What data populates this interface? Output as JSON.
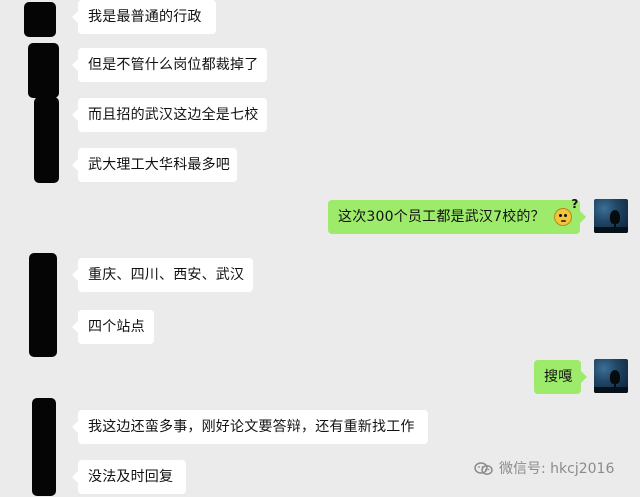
{
  "chat": {
    "messages": [
      {
        "direction": "incoming",
        "text": "我是最普通的行政"
      },
      {
        "direction": "incoming",
        "text": "但是不管什么岗位都裁掉了"
      },
      {
        "direction": "incoming",
        "text": "而且招的武汉这边全是七校"
      },
      {
        "direction": "incoming",
        "text": "武大理工大华科最多吧"
      },
      {
        "direction": "outgoing",
        "text": "这次300个员工都是武汉7校的？",
        "emoji": "?"
      },
      {
        "direction": "incoming",
        "text": "重庆、四川、西安、武汉"
      },
      {
        "direction": "incoming",
        "text": "四个站点"
      },
      {
        "direction": "outgoing",
        "text": "搜嘎"
      },
      {
        "direction": "incoming",
        "text": "我这边还蛮多事，刚好论文要答辩，还有重新找工作"
      },
      {
        "direction": "incoming",
        "text": "没法及时回复"
      }
    ]
  },
  "watermark": {
    "text": "微信号: hkcj2016"
  },
  "colors": {
    "background": "#ebebeb",
    "incoming_bubble": "#ffffff",
    "outgoing_bubble": "#9eea6a",
    "text": "#111111",
    "watermark": "#8b8b8b"
  },
  "icons": {
    "avatar": "night-tree-avatar",
    "emoji": "confused-face-emoji",
    "watermark": "wechat-watermark-icon"
  }
}
